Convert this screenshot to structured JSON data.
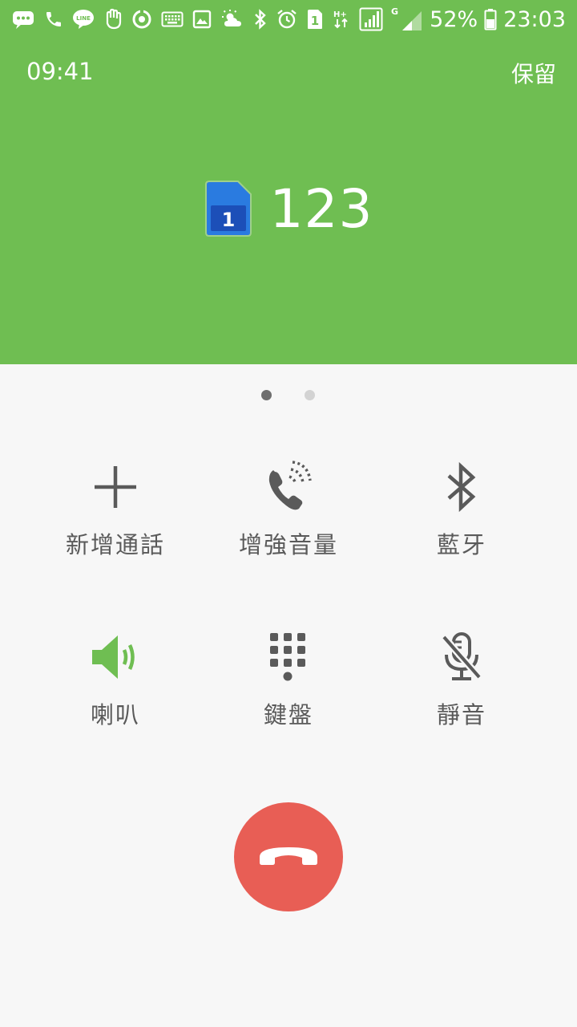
{
  "status_bar": {
    "battery": "52%",
    "clock": "23:03",
    "network_h": "H+",
    "network_g": "G",
    "sim_badge": "1",
    "line_label": "LINE",
    "icons": [
      "chat-bubble-icon",
      "phone-icon",
      "line-app-icon",
      "hand-icon",
      "sync-icon",
      "keyboard-icon",
      "image-icon",
      "weather-icon",
      "bluetooth-icon",
      "alarm-icon",
      "sim1-icon",
      "data-arrows-icon",
      "signal-icon",
      "signal-icon",
      "battery-icon"
    ]
  },
  "call": {
    "timer": "09:41",
    "hold_label": "保留",
    "number": "123",
    "sim_slot": "1"
  },
  "pager": {
    "pages": 2,
    "active": 1
  },
  "actions": [
    {
      "label": "新增通話",
      "icon": "plus-icon"
    },
    {
      "label": "增強音量",
      "icon": "phone-volume-icon"
    },
    {
      "label": "藍牙",
      "icon": "bluetooth-icon"
    },
    {
      "label": "喇叭",
      "icon": "speaker-icon",
      "active": true
    },
    {
      "label": "鍵盤",
      "icon": "keypad-icon"
    },
    {
      "label": "靜音",
      "icon": "mic-off-icon"
    }
  ],
  "colors": {
    "header_bg": "#6fbe52",
    "body_bg": "#f7f7f7",
    "end_call": "#e85e55",
    "icon_gray": "#5a5a5a",
    "speaker_active": "#6fbe52",
    "sim_blue": "#2a6fd6"
  }
}
